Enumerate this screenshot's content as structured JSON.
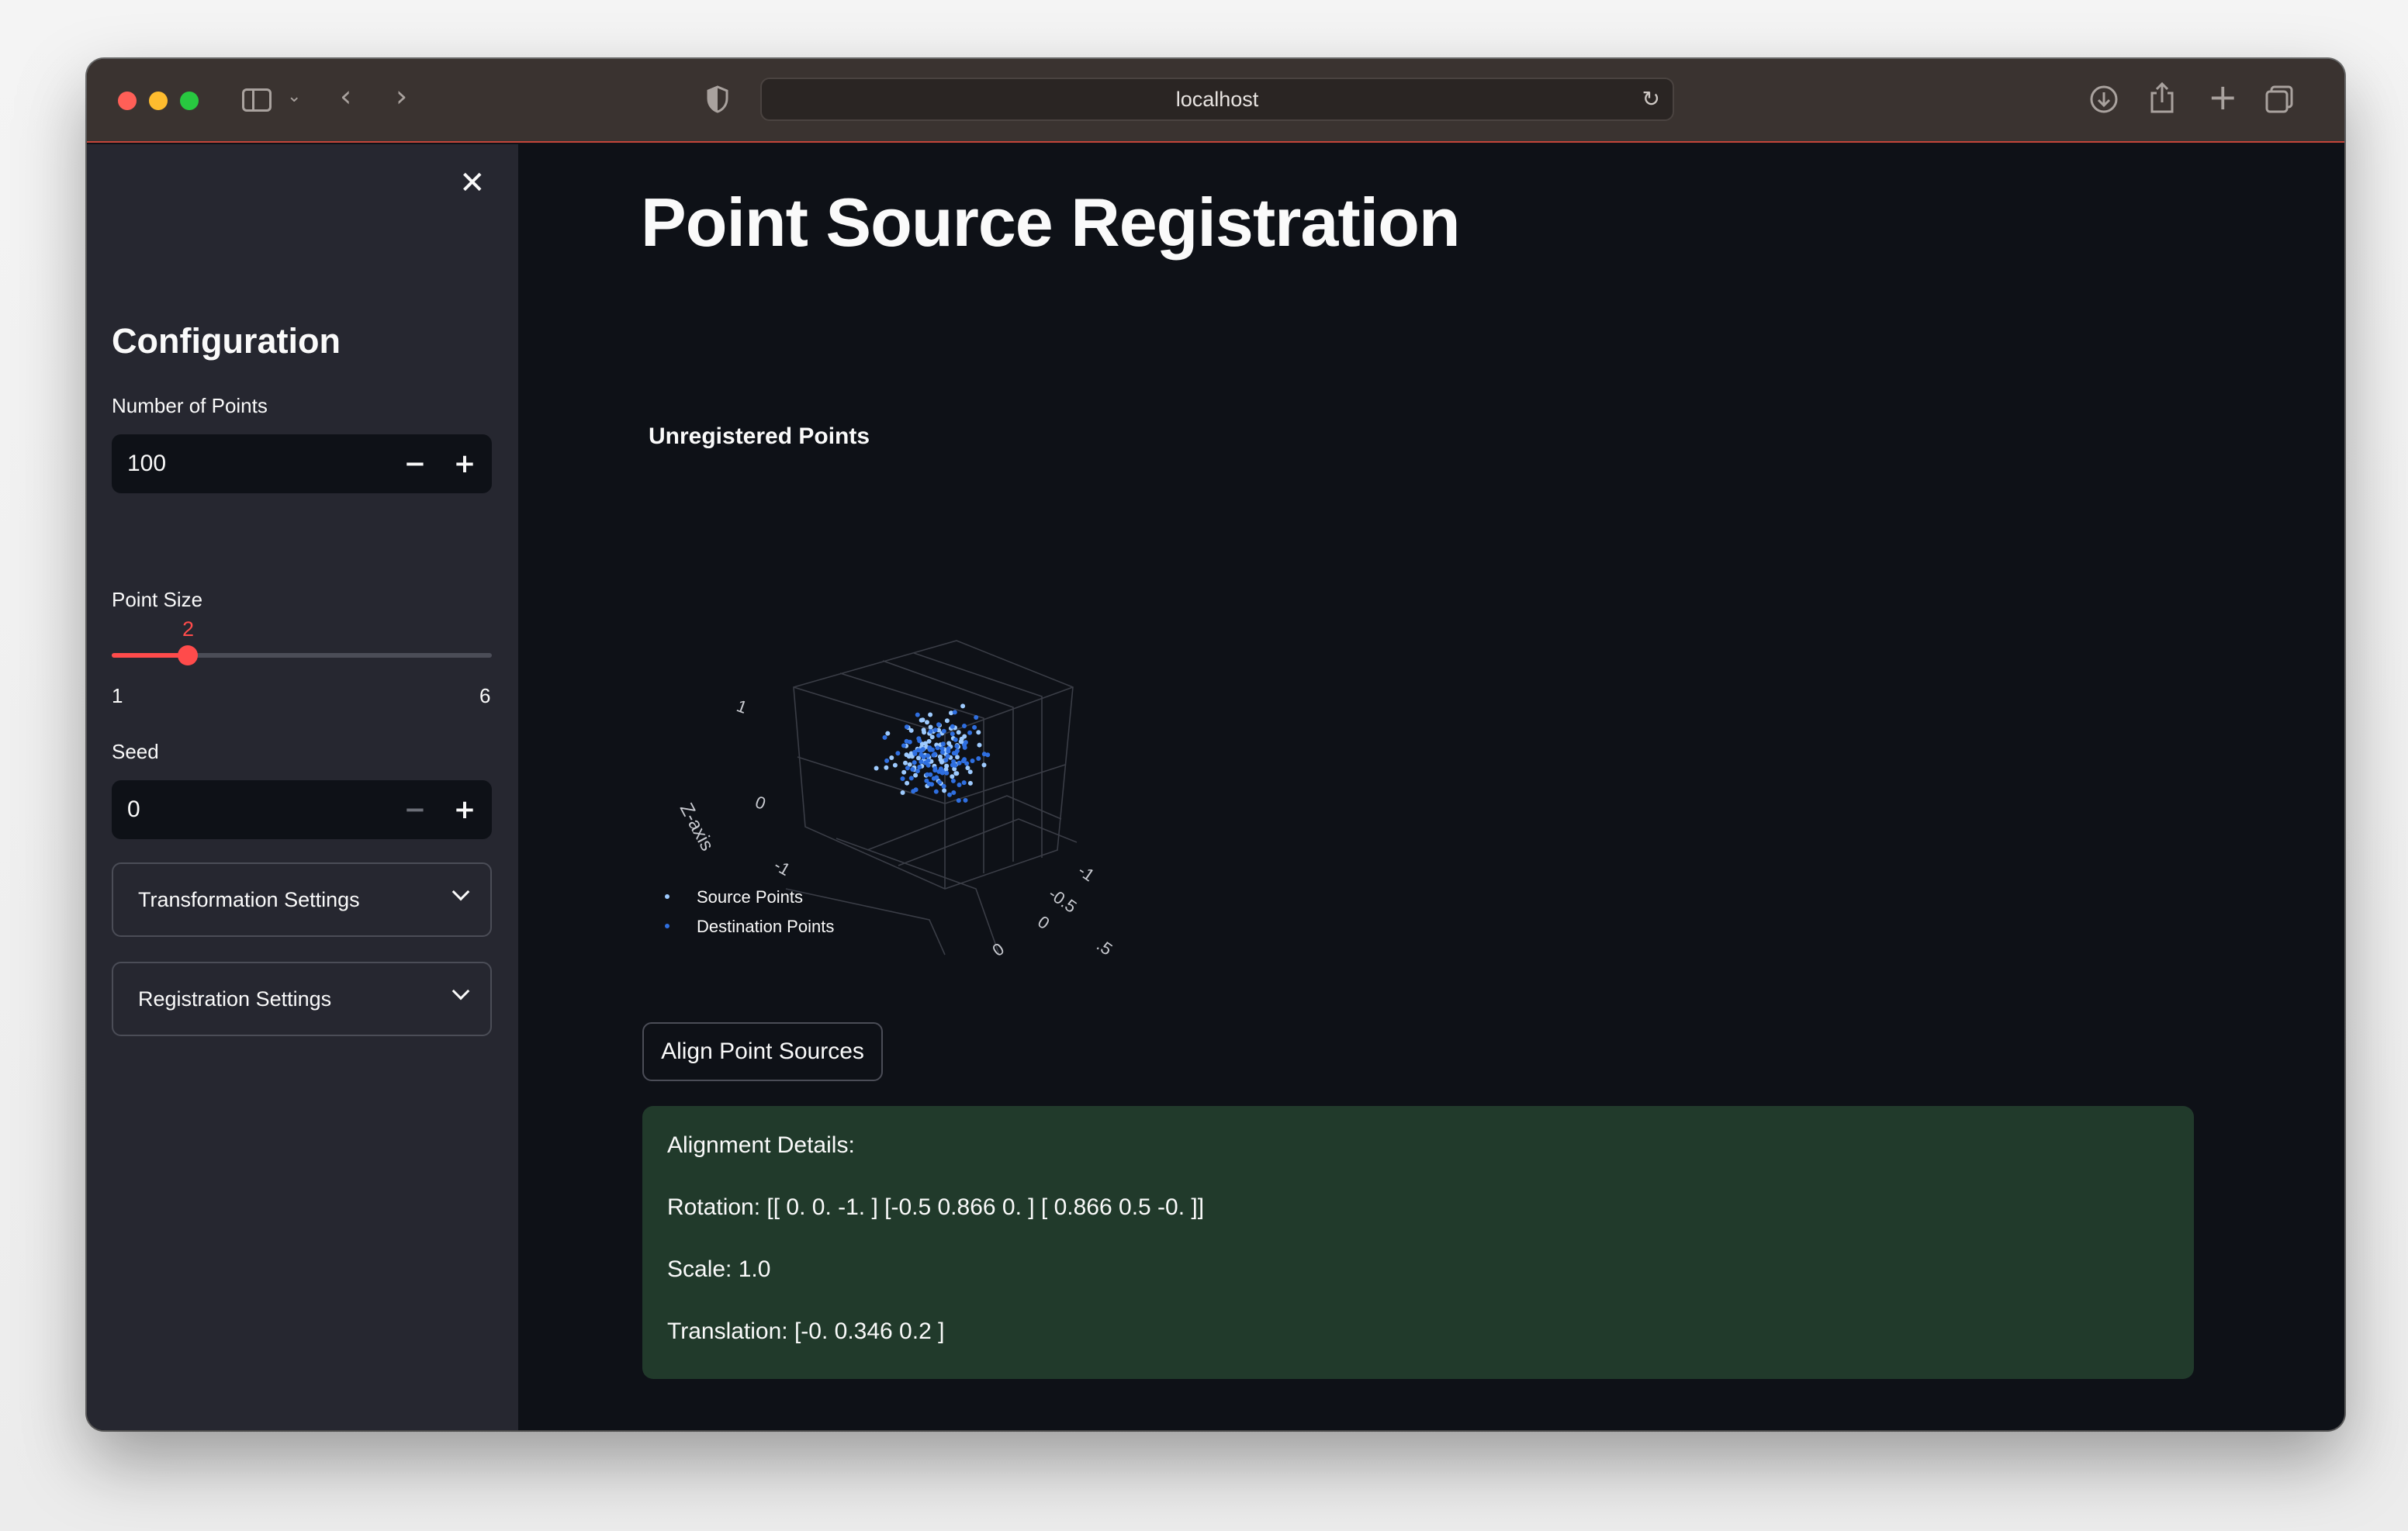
{
  "browser": {
    "url": "localhost"
  },
  "sidebar": {
    "title": "Configuration",
    "num_points": {
      "label": "Number of Points",
      "value": "100",
      "minus": "−",
      "plus": "+"
    },
    "point_size": {
      "label": "Point Size",
      "value": 2,
      "value_label": "2",
      "min": 1,
      "max": 6,
      "min_label": "1",
      "max_label": "6"
    },
    "seed": {
      "label": "Seed",
      "value": "0",
      "minus": "−",
      "plus": "+"
    },
    "expanders": [
      {
        "label": "Transformation Settings"
      },
      {
        "label": "Registration Settings"
      }
    ],
    "close_glyph": "✕"
  },
  "main": {
    "title": "Point Source Registration",
    "chart_title": "Unregistered Points",
    "align_button": "Align Point Sources",
    "details": {
      "heading": "Alignment Details:",
      "rotation": "Rotation: [[ 0. 0. -1. ] [-0.5 0.866 0. ] [ 0.866 0.5 -0. ]]",
      "scale": "Scale: 1.0",
      "translation": "Translation: [-0. 0.346 0.2 ]"
    }
  },
  "chart_data": {
    "type": "scatter",
    "title": "Unregistered Points",
    "zlabel": "Z-axis",
    "z_ticks": [
      "1",
      "0",
      "-1"
    ],
    "y_ticks": [
      "-1",
      "-0.5",
      "0",
      ".5"
    ],
    "x_ticks": [
      "",
      "0"
    ],
    "legend": [
      "Source Points",
      "Destination Points"
    ],
    "legend_position": "bottom-left",
    "series": [
      {
        "name": "Source Points",
        "color": "#9ecbff",
        "count": 100
      },
      {
        "name": "Destination Points",
        "color": "#2f6fe0",
        "count": 100
      }
    ]
  },
  "colors": {
    "accent": "#ff4b4b",
    "success_bg": "#213a2b",
    "sidebar_bg": "#262730",
    "main_bg": "#0e1117"
  }
}
